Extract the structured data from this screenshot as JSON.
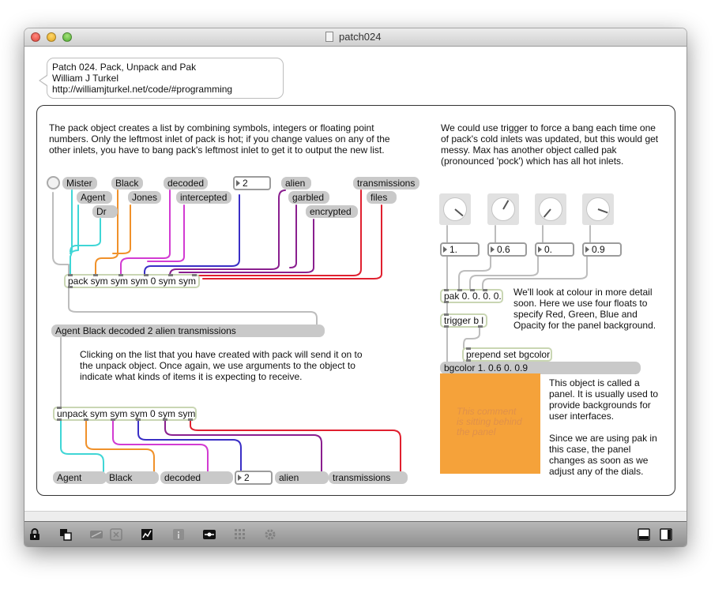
{
  "window": {
    "title": "patch024"
  },
  "header_comment": {
    "line1": "Patch 024. Pack, Unpack and Pak",
    "line2": "William J Turkel",
    "line3": "http://williamjturkel.net/code/#programming"
  },
  "left": {
    "intro": "The pack object creates a list by combining symbols, integers or floating point\nnumbers. Only the leftmost inlet of pack is hot; if you change values on any of the\nother inlets, you have to bang pack's leftmost inlet to get it to output the new list.",
    "messages": {
      "mister": "Mister",
      "agent": "Agent",
      "dr": "Dr",
      "black": "Black",
      "jones": "Jones",
      "decoded": "decoded",
      "intercepted": "intercepted",
      "alien": "alien",
      "garbled": "garbled",
      "encrypted": "encrypted",
      "transmissions": "transmissions",
      "files": "files"
    },
    "number_in": "2",
    "pack_object": "pack sym sym sym 0 sym sym",
    "list_message": "Agent Black decoded 2 alien transmissions",
    "middle_comment": "Clicking on the list that you have created with pack will send it on to\nthe unpack object. Once again, we use arguments to the object to\nindicate what kinds of items it is expecting to receive.",
    "unpack_object": "unpack sym sym sym 0 sym sym",
    "outputs": {
      "agent": "Agent",
      "black": "Black",
      "decoded": "decoded",
      "number": "2",
      "alien": "alien",
      "transmissions": "transmissions"
    }
  },
  "right": {
    "intro": "We could use trigger to force a bang each time one\nof pack's cold inlets was updated, but this would get\nmessy. Max has another object called pak\n(pronounced 'pock') which has all hot inlets.",
    "dial_values": [
      "1.",
      "0.6",
      "0.",
      "0.9"
    ],
    "pak_object": "pak 0. 0. 0. 0.",
    "pak_comment": "We'll look at colour in more detail\nsoon. Here we use four floats to\nspecify Red, Green, Blue and\nOpacity for the panel background.",
    "trigger_object": "trigger b l",
    "prepend_object": "prepend set bgcolor",
    "bgcolor_message": "bgcolor 1. 0.6 0. 0.9",
    "panel_inner_comment": "This comment\nis sitting behind\nthe panel",
    "panel_comment": "This object is called a\npanel. It is usually used to\nprovide backgrounds for\nuser interfaces.\n\nSince we are using pak in\nthis case, the panel\nchanges as soon as we\nadjust any of the dials.",
    "panel_color": "#f5a23a"
  },
  "wire_colors": {
    "gray": "#bdbdbd",
    "cyan": "#3fd6d6",
    "orange": "#f0912a",
    "magenta": "#d23bd2",
    "blue": "#3a2fc6",
    "purple": "#8a1f8f",
    "red": "#e0202f"
  },
  "toolbar_icons": [
    "lock-icon",
    "presentation-icon",
    "patch-cord-icon",
    "clear-icon",
    "inspector-chart-icon",
    "info-icon",
    "debug-icon",
    "grid-icon",
    "gear-icon",
    "sidebar-bottom-icon",
    "sidebar-right-icon"
  ]
}
